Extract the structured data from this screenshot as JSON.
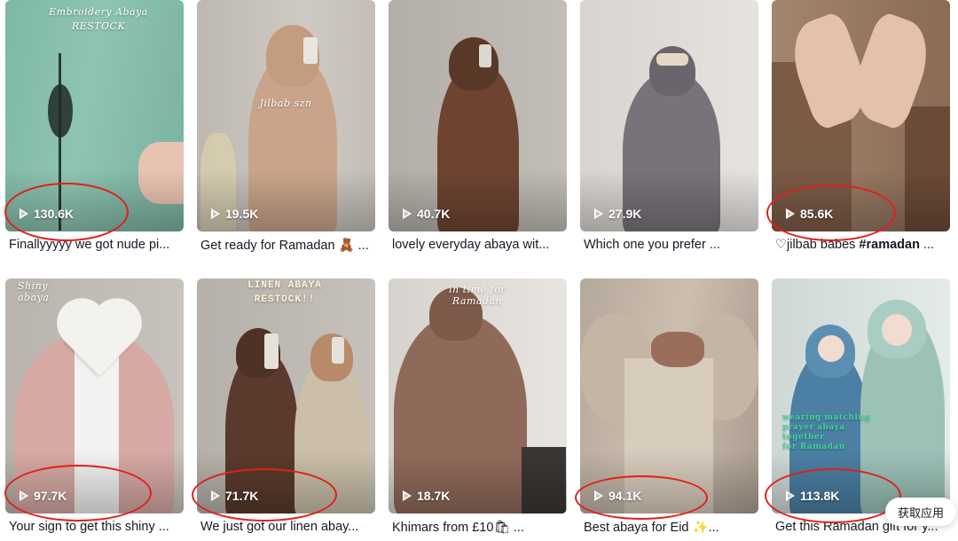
{
  "videos": [
    {
      "views": "130.6K",
      "caption": "Finallyyyyy we got nude pi...",
      "overlay": "Embroidery Abaya\nRESTOCK"
    },
    {
      "views": "19.5K",
      "caption": "Get ready for Ramadan 🧸 ...",
      "overlay": "Jilbab szn"
    },
    {
      "views": "40.7K",
      "caption": "lovely everyday abaya wit...",
      "overlay": ""
    },
    {
      "views": "27.9K",
      "caption": "Which one you prefer ...",
      "overlay": ""
    },
    {
      "views": "85.6K",
      "caption_prefix": "♡jilbab babes ",
      "caption_bold": "#ramadan",
      "caption_suffix": " ...",
      "overlay": ""
    },
    {
      "views": "97.7K",
      "caption": "Your sign to get this shiny ...",
      "overlay": "Shiny abaya"
    },
    {
      "views": "71.7K",
      "caption": "We just got our linen abay...",
      "overlay": "LINEN ABAYA\nRESTOCK!!"
    },
    {
      "views": "18.7K",
      "caption": "Khimars from £10🛍 ...",
      "overlay": "in time for Ramadan"
    },
    {
      "views": "94.1K",
      "caption": "Best abaya for Eid ✨...",
      "overlay": ""
    },
    {
      "views": "113.8K",
      "caption": "Get this Ramadan gift for y...",
      "overlay": "wearing matching\nprayer abaya together\nfor Ramadan"
    }
  ],
  "get_app_label": "获取应用",
  "colors": {
    "annotation": "#e0201b",
    "caption_text": "#161823"
  }
}
